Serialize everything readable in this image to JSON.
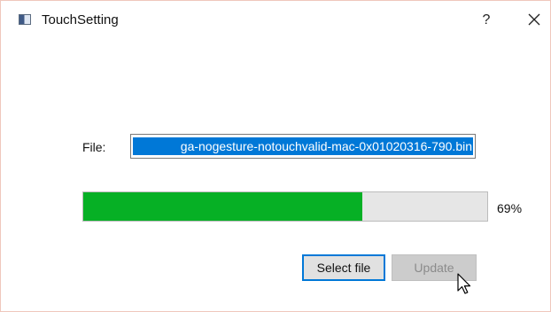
{
  "window": {
    "title": "TouchSetting",
    "help_label": "?",
    "icons": {
      "app": "app-window-icon",
      "close": "close-icon",
      "cursor": "mouse-pointer-icon"
    }
  },
  "form": {
    "file_label": "File:",
    "file_value": "ga-nogesture-notouchvalid-mac-0x01020316-790.bin",
    "progress_fraction": 0.69,
    "progress_text": "69%"
  },
  "buttons": {
    "select_file": "Select file",
    "update": "Update"
  },
  "colors": {
    "progress_fill": "#06b025",
    "selection": "#0078d7"
  }
}
